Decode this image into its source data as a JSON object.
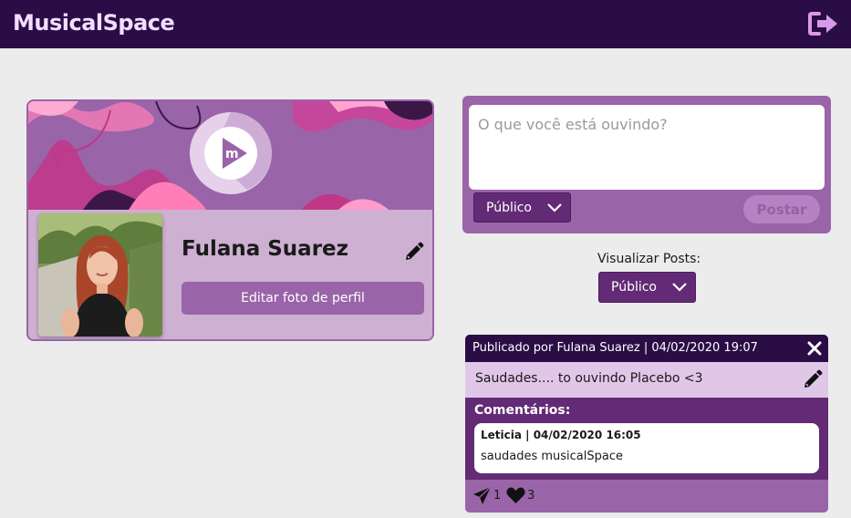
{
  "header": {
    "app_name": "MusicalSpace",
    "logout_icon": "logout-icon"
  },
  "profile": {
    "name": "Fulana Suarez",
    "edit_photo_label": "Editar foto de perfil",
    "edit_icon": "pencil-icon"
  },
  "composer": {
    "placeholder": "O que você está ouvindo?",
    "visibility": "Público",
    "post_label": "Postar"
  },
  "view_filter": {
    "label": "Visualizar Posts:",
    "value": "Público"
  },
  "post": {
    "meta": "Publicado por Fulana Suarez | 04/02/2020 19:07",
    "text": "Saudades.... to ouvindo Placebo <3",
    "comments_title": "Comentários:",
    "comments": [
      {
        "meta": "Leticia | 04/02/2020 16:05",
        "text": "saudades musicalSpace"
      }
    ],
    "shares": "1",
    "likes": "3"
  },
  "colors": {
    "topbar": "#2a0d45",
    "accent": "#9a64a8",
    "dark_purple": "#632a75",
    "light_purple": "#cdb0d2"
  }
}
